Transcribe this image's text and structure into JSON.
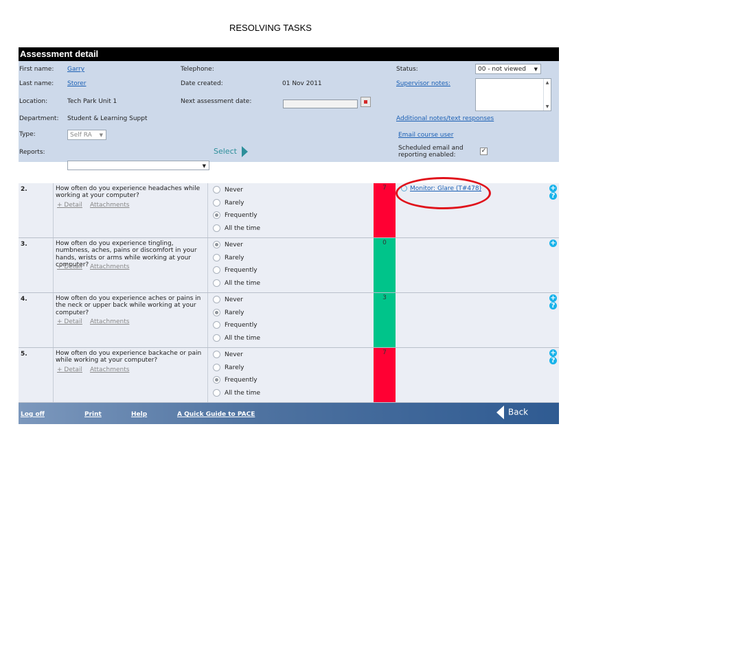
{
  "slide_title": "RESOLVING TASKS",
  "header": {
    "title": "Assessment detail"
  },
  "info": {
    "first_name_label": "First name:",
    "first_name": "Garry",
    "last_name_label": "Last name:",
    "last_name": "Storer",
    "location_label": "Location:",
    "location": "Tech Park Unit 1",
    "department_label": "Department:",
    "department": "Student & Learning Suppt",
    "type_label": "Type:",
    "type_value": "Self RA",
    "reports_label": "Reports:",
    "reports_value": "",
    "select_label": "Select",
    "telephone_label": "Telephone:",
    "telephone": "",
    "date_created_label": "Date created:",
    "date_created": "01 Nov 2011",
    "next_assessment_label": "Next assessment date:",
    "next_assessment": "",
    "status_label": "Status:",
    "status_value": "00 - not viewed",
    "supervisor_notes_label": "Supervisor notes:",
    "supervisor_notes": "",
    "additional_notes_link": "Additional notes/text responses",
    "email_link": "Email course user",
    "scheduled_label_1": "Scheduled email and",
    "scheduled_label_2": "reporting enabled:",
    "scheduled_checked": true
  },
  "options": [
    "Never",
    "Rarely",
    "Frequently",
    "All the time"
  ],
  "detail_link": "+ Detail",
  "attachments_link": "Attachments",
  "questions": [
    {
      "num": "2.",
      "text": "How often do you experience headaches while working at your computer?",
      "selected": 2,
      "score": "7",
      "color": "#ff0033",
      "task": "Monitor: Glare (T#478)"
    },
    {
      "num": "3.",
      "text": "How often do you experience tingling, numbness, aches, pains or discomfort in your hands, wrists or arms while working at your computer?",
      "selected": 0,
      "score": "0",
      "color": "#00c48a"
    },
    {
      "num": "4.",
      "text": "How often do you experience aches or pains in the neck or upper back while working at your computer?",
      "selected": 1,
      "score": "3",
      "color": "#00c48a"
    },
    {
      "num": "5.",
      "text": "How often do you experience backache or pain while working at your computer?",
      "selected": 2,
      "score": "7",
      "color": "#ff0033"
    }
  ],
  "footer": {
    "logoff": "Log off",
    "print": "Print",
    "help": "Help",
    "guide": "A Quick Guide to PACE",
    "back": "Back"
  },
  "colors": {
    "highlight_circle": "#e0121b",
    "header_bg": "#000000",
    "info_bg": "#cdd9ea"
  }
}
